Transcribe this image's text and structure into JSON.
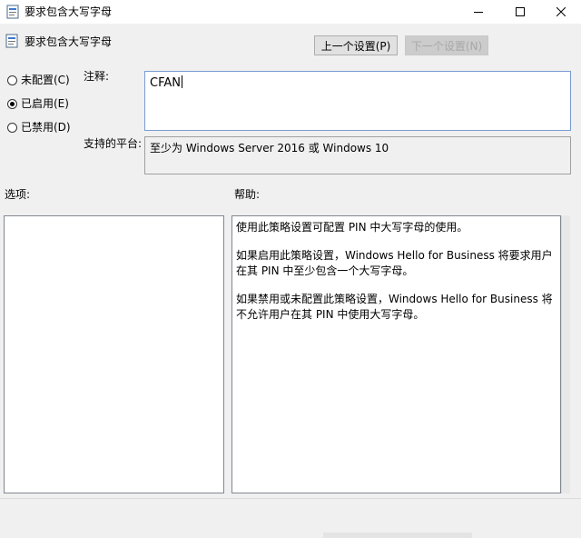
{
  "window": {
    "title": "要求包含大写字母",
    "icons": {
      "app": "policy-settings-icon",
      "minimize": "minimize-icon",
      "maximize": "maximize-icon",
      "close": "close-icon"
    }
  },
  "policy": {
    "name": "要求包含大写字母"
  },
  "navigation": {
    "prev_label": "上一个设置(P)",
    "next_label": "下一个设置(N)"
  },
  "state": {
    "options": [
      {
        "label": "未配置(C)",
        "checked": false
      },
      {
        "label": "已启用(E)",
        "checked": true
      },
      {
        "label": "已禁用(D)",
        "checked": false
      }
    ]
  },
  "comment": {
    "label": "注释:",
    "value": "CFAN"
  },
  "platform": {
    "label": "支持的平台:",
    "value": "至少为 Windows Server 2016 或 Windows 10"
  },
  "options_section": {
    "label": "选项:"
  },
  "help_section": {
    "label": "帮助:",
    "paragraphs": [
      "使用此策略设置可配置 PIN 中大写字母的使用。",
      "如果启用此策略设置，Windows Hello for Business 将要求用户在其 PIN 中至少包含一个大写字母。",
      "如果禁用或未配置此策略设置，Windows Hello for Business 将不允许用户在其 PIN 中使用大写字母。"
    ]
  },
  "colors": {
    "accent_border": "#7a9cd3",
    "window_bg": "#f0f0f0",
    "disabled_text": "#a8a8a8"
  }
}
